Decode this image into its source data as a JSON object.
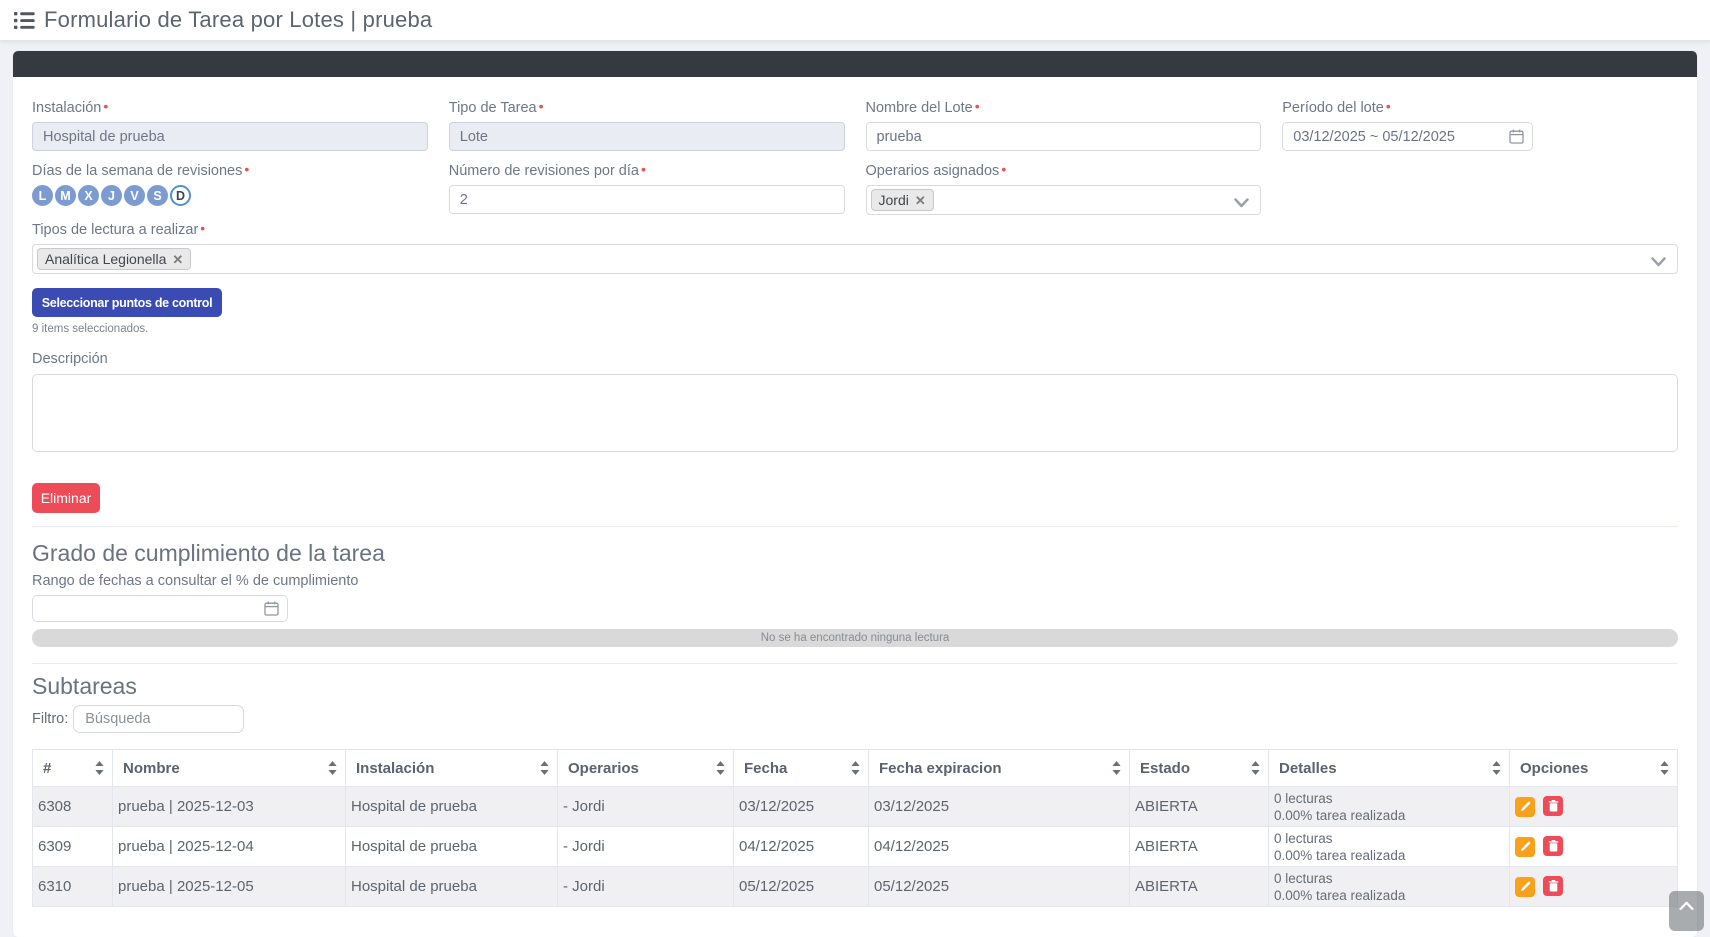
{
  "page": {
    "title": "Formulario de Tarea por Lotes | prueba"
  },
  "form": {
    "instalacion": {
      "label": "Instalación",
      "value": "Hospital de prueba",
      "required": true
    },
    "tipo_tarea": {
      "label": "Tipo de Tarea",
      "value": "Lote",
      "required": true
    },
    "nombre_lote": {
      "label": "Nombre del Lote",
      "value": "prueba",
      "required": true
    },
    "periodo_lote": {
      "label": "Período del lote",
      "value": "03/12/2025 ~ 05/12/2025",
      "required": true
    },
    "dias_semana": {
      "label": "Días de la semana de revisiones",
      "required": true,
      "days": [
        {
          "label": "L",
          "selected": true
        },
        {
          "label": "M",
          "selected": true
        },
        {
          "label": "X",
          "selected": true
        },
        {
          "label": "J",
          "selected": true
        },
        {
          "label": "V",
          "selected": true
        },
        {
          "label": "S",
          "selected": true
        },
        {
          "label": "D",
          "selected": false
        }
      ]
    },
    "num_revisiones": {
      "label": "Número de revisiones por día",
      "value": "2",
      "required": true
    },
    "operarios": {
      "label": "Operarios asignados",
      "required": true,
      "tags": [
        {
          "label": "Jordi"
        }
      ],
      "remove_symbol": "✕"
    },
    "tipos_lectura": {
      "label": "Tipos de lectura a realizar",
      "required": true,
      "tags": [
        {
          "label": "Analítica Legionella"
        }
      ],
      "remove_symbol": "✕"
    },
    "select_points_button": "Seleccionar puntos de control",
    "items_selected_note": "9 items seleccionados.",
    "descripcion": {
      "label": "Descripción",
      "value": ""
    },
    "delete_button": "Eliminar"
  },
  "compliance": {
    "heading": "Grado de cumplimiento de la tarea",
    "range_label": "Rango de fechas a consultar el % de cumplimiento",
    "range_value": "",
    "empty_message": "No se ha encontrado ninguna lectura"
  },
  "subtasks": {
    "heading": "Subtareas",
    "filter_label": "Filtro:",
    "filter_placeholder": "Búsqueda",
    "columns": [
      {
        "label": "#"
      },
      {
        "label": "Nombre"
      },
      {
        "label": "Instalación"
      },
      {
        "label": "Operarios"
      },
      {
        "label": "Fecha"
      },
      {
        "label": "Fecha expiracion"
      },
      {
        "label": "Estado"
      },
      {
        "label": "Detalles"
      },
      {
        "label": "Opciones"
      }
    ],
    "rows": [
      {
        "id": "6308",
        "nombre": "prueba | 2025-12-03",
        "instalacion": "Hospital de prueba",
        "operarios": "- Jordi",
        "fecha": "03/12/2025",
        "fecha_expiracion": "03/12/2025",
        "estado": "ABIERTA",
        "detalles_line1": "0 lecturas",
        "detalles_line2": "0.00% tarea realizada"
      },
      {
        "id": "6309",
        "nombre": "prueba | 2025-12-04",
        "instalacion": "Hospital de prueba",
        "operarios": "- Jordi",
        "fecha": "04/12/2025",
        "fecha_expiracion": "04/12/2025",
        "estado": "ABIERTA",
        "detalles_line1": "0 lecturas",
        "detalles_line2": "0.00% tarea realizada"
      },
      {
        "id": "6310",
        "nombre": "prueba | 2025-12-05",
        "instalacion": "Hospital de prueba",
        "operarios": "- Jordi",
        "fecha": "05/12/2025",
        "fecha_expiracion": "05/12/2025",
        "estado": "ABIERTA",
        "detalles_line1": "0 lecturas",
        "detalles_line2": "0.00% tarea realizada"
      }
    ]
  }
}
